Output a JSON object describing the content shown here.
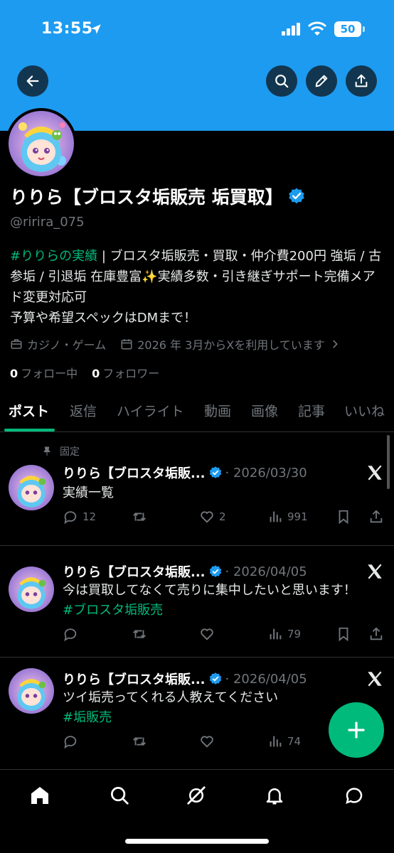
{
  "status_bar": {
    "time": "13:55",
    "battery": "50"
  },
  "profile": {
    "display_name": "りりら【ブロスタ垢販売 垢買取】",
    "handle": "@ririra_075",
    "bio_hashtag": "#りりらの実績",
    "bio_line1": " | ブロスタ垢販売・買取・仲介費200円 強垢 / 古参垢 / 引退垢 在庫豊富✨実績多数・引き継ぎサポート完備メアド変更対応可",
    "bio_line2": "予算や希望スペックはDMまで！",
    "category": "カジノ・ゲーム",
    "joined": "2026 年 3月からXを利用しています",
    "following_count": "0",
    "following_label": "フォロー中",
    "followers_count": "0",
    "followers_label": "フォロワー"
  },
  "tabs": [
    {
      "label": "ポスト"
    },
    {
      "label": "返信"
    },
    {
      "label": "ハイライト"
    },
    {
      "label": "動画"
    },
    {
      "label": "画像"
    },
    {
      "label": "記事"
    },
    {
      "label": "いいね"
    }
  ],
  "pinned_label": "固定",
  "posts": [
    {
      "author": "りりら【ブロスタ垢販...",
      "date": "· 2026/03/30",
      "text": "実績一覧",
      "hashtag": "",
      "replies": "12",
      "reposts": "",
      "likes": "2",
      "views": "991"
    },
    {
      "author": "りりら【ブロスタ垢販...",
      "date": "· 2026/04/05",
      "text": "今は買取してなくて売りに集中したいと思います！ ",
      "hashtag": "#ブロスタ垢販売",
      "replies": "",
      "reposts": "",
      "likes": "",
      "views": "79"
    },
    {
      "author": "りりら【ブロスタ垢販...",
      "date": "· 2026/04/05",
      "text": "ツイ垢売ってくれる人教えてください",
      "hashtag": "#垢販売",
      "replies": "",
      "reposts": "",
      "likes": "",
      "views": "74"
    }
  ],
  "colors": {
    "banner": "#1d9bf0",
    "accent": "#00ba7c",
    "verified": "#1d9bf0"
  }
}
